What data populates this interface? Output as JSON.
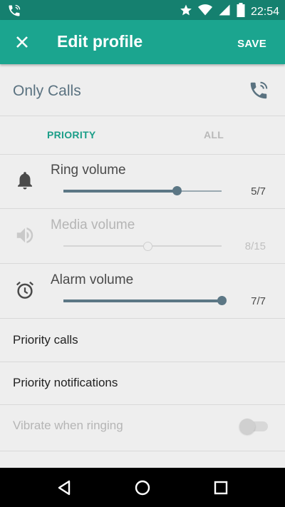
{
  "status_bar": {
    "time": "22:54"
  },
  "app_bar": {
    "title": "Edit profile",
    "save_label": "SAVE"
  },
  "profile": {
    "name": "Only Calls"
  },
  "tabs": [
    {
      "label": "PRIORITY",
      "active": true
    },
    {
      "label": "ALL",
      "active": false
    }
  ],
  "volumes": [
    {
      "label": "Ring volume",
      "value_text": "5/7",
      "fraction": 0.714,
      "enabled": true
    },
    {
      "label": "Media volume",
      "value_text": "8/15",
      "fraction": 0.533,
      "enabled": false
    },
    {
      "label": "Alarm volume",
      "value_text": "7/7",
      "fraction": 1.0,
      "enabled": true
    }
  ],
  "settings": [
    {
      "label": "Priority calls"
    },
    {
      "label": "Priority notifications"
    },
    {
      "label": "Vibrate when ringing",
      "enabled": false,
      "toggle_on": false
    }
  ],
  "colors": {
    "accent": "#1ba58f",
    "status_bar": "#15806f",
    "slider": "#5c7785"
  }
}
